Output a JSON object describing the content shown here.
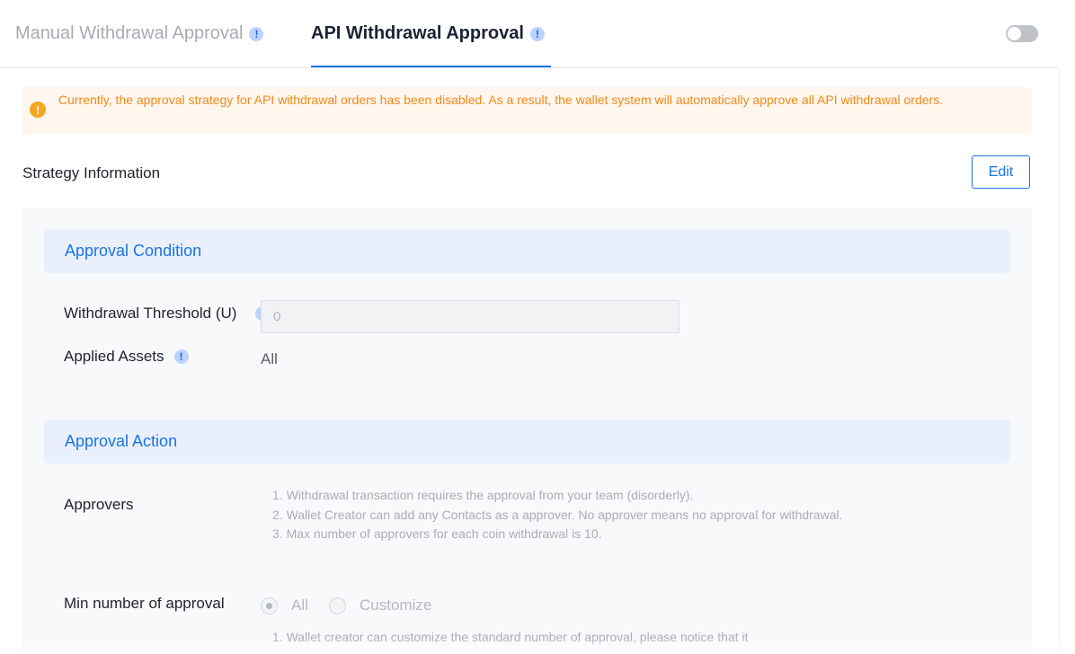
{
  "tabs": [
    {
      "label": "Manual Withdrawal Approval",
      "active": false
    },
    {
      "label": "API Withdrawal Approval",
      "active": true
    }
  ],
  "toggle": {
    "enabled": false
  },
  "alert": {
    "icon": "warning-icon",
    "text": "Currently, the approval strategy for API withdrawal orders has been disabled. As a result, the wallet system will automatically approve all API withdrawal orders."
  },
  "strategy": {
    "title": "Strategy Information",
    "edit_label": "Edit"
  },
  "approval_condition": {
    "title": "Approval Condition",
    "threshold_label": "Withdrawal Threshold (U)",
    "threshold_value": "0",
    "assets_label": "Applied Assets",
    "assets_value": "All"
  },
  "approval_action": {
    "title": "Approval Action",
    "approvers_label": "Approvers",
    "approvers_hints": [
      "1. Withdrawal transaction requires the approval from your team (disorderly).",
      "2. Wallet Creator can add any Contacts as a approver. No approver means no approval for withdrawal.",
      "3. Max number of approvers for each coin withdrawal is 10."
    ],
    "min_label": "Min number of approval",
    "options": [
      {
        "label": "All",
        "checked": true
      },
      {
        "label": "Customize",
        "checked": false
      }
    ],
    "min_hint": "1. Wallet creator can customize the standard number of approval, please notice that it"
  },
  "colors": {
    "accent": "#1a73e8",
    "warning_text": "#f08a1a",
    "warning_bg": "#fff6ed",
    "info_icon": "#bcd3ff"
  }
}
